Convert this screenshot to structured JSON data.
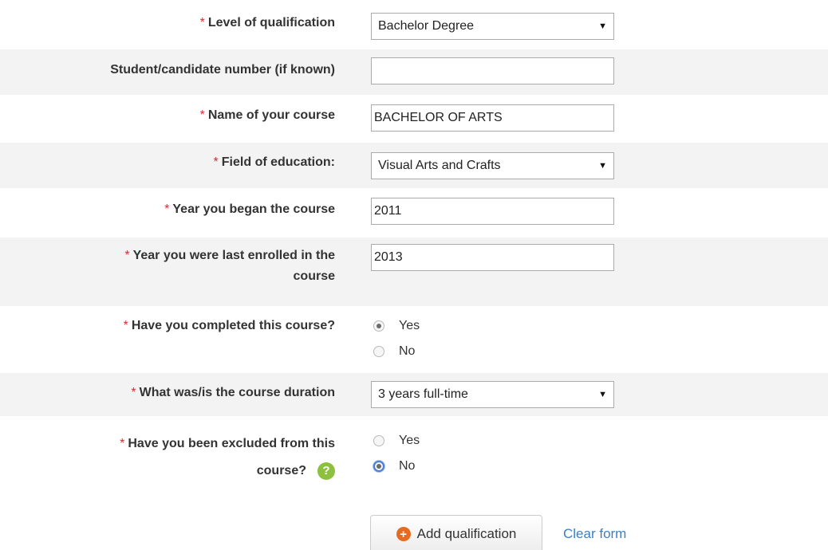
{
  "form": {
    "required_marker": "*",
    "level": {
      "label": "Level of qualification",
      "value": "Bachelor Degree"
    },
    "student_number": {
      "label": "Student/candidate number (if known)",
      "value": ""
    },
    "course_name": {
      "label": "Name of your course",
      "value": "BACHELOR OF ARTS"
    },
    "field": {
      "label": "Field of education:",
      "value": "Visual Arts and Crafts"
    },
    "year_began": {
      "label": "Year you began the course",
      "value": "2011"
    },
    "year_last": {
      "label_line1": "Year you were last enrolled in the",
      "label_line2": "course",
      "value": "2013"
    },
    "completed": {
      "label": "Have you completed this course?",
      "options": [
        {
          "label": "Yes",
          "checked": true
        },
        {
          "label": "No",
          "checked": false
        }
      ]
    },
    "duration": {
      "label": "What was/is the course duration",
      "value": "3 years full-time"
    },
    "excluded": {
      "label_line1": "Have you been excluded from this",
      "label_line2": "course?",
      "help_icon": "question-circle-icon",
      "help_glyph": "?",
      "options": [
        {
          "label": "Yes",
          "checked": false
        },
        {
          "label": "No",
          "checked": true
        }
      ]
    },
    "actions": {
      "add_icon": "plus-circle-icon",
      "add_glyph": "+",
      "add_label": "Add qualification",
      "clear_label": "Clear form"
    }
  },
  "colors": {
    "alt_row": "#f3f3f3",
    "required": "#cc3333",
    "link": "#3b7fc4",
    "help": "#8dc03f",
    "add_icon": "#e66a1f"
  }
}
